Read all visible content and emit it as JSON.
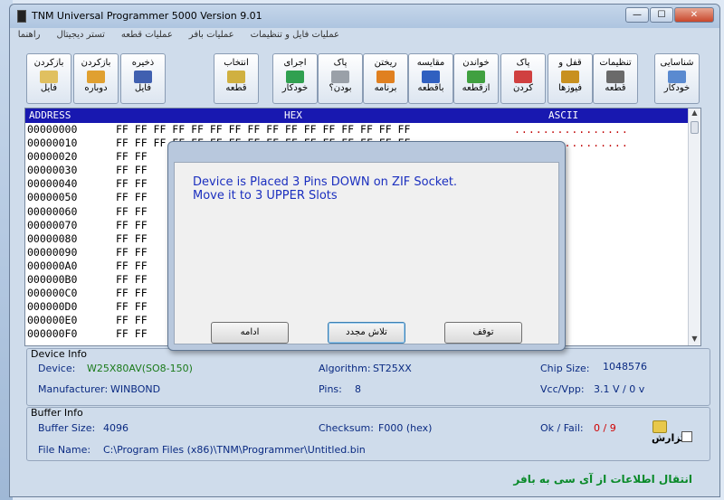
{
  "window": {
    "title": "TNM  Universal Programmer 5000   Version 9.01",
    "buttons": {
      "minimize": "—",
      "maximize": "☐",
      "close": "✕"
    }
  },
  "menu": [
    "عملیات فایل و تنظیمات",
    "عملیات بافر",
    "عملیات قطعه",
    "تستر دیجیتال",
    "راهنما"
  ],
  "toolbar": [
    {
      "l1": "شناسایی",
      "l2": "خودکار",
      "icon": "chip-search-icon",
      "color": "#5a8ad0"
    },
    {
      "l1": "تنظیمات",
      "l2": "قطعه",
      "icon": "chip-settings-icon",
      "color": "#6a6a6a"
    },
    {
      "l1": "قفل و",
      "l2": "فیوزها",
      "icon": "lock-icon",
      "color": "#c89020"
    },
    {
      "l1": "پاک",
      "l2": "کردن",
      "icon": "eraser-icon",
      "color": "#d04040"
    },
    {
      "l1": "خواندن",
      "l2": "ازقطعه",
      "icon": "read-chip-icon",
      "color": "#40a040"
    },
    {
      "l1": "مقایسه",
      "l2": "باقطعه",
      "icon": "compare-icon",
      "color": "#3060c0"
    },
    {
      "l1": "ریختن",
      "l2": "برنامه",
      "icon": "program-chip-icon",
      "color": "#e08020"
    },
    {
      "l1": "پاک",
      "l2": "بودن؟",
      "icon": "blank-check-icon",
      "color": "#9aa0a8"
    },
    {
      "l1": "اجرای",
      "l2": "خودکار",
      "icon": "auto-run-icon",
      "color": "#30a050"
    },
    {
      "l1": "انتخاب",
      "l2": "قطعه",
      "icon": "select-chip-icon",
      "color": "#d0b040"
    },
    {
      "l1": "ذخیره",
      "l2": "فایل",
      "icon": "save-file-icon",
      "color": "#4060b0"
    },
    {
      "l1": "بازکردن",
      "l2": "دوباره",
      "icon": "reopen-file-icon",
      "color": "#e0a030"
    },
    {
      "l1": "بازکردن",
      "l2": "فایل",
      "icon": "open-file-icon",
      "color": "#e0c060"
    }
  ],
  "grid": {
    "headers": {
      "address": "ADDRESS",
      "hex": "HEX",
      "ascii": "ASCII"
    },
    "rows": [
      {
        "addr": "00000000",
        "hex": "FF FF FF FF FF FF FF FF FF FF FF FF FF FF FF FF",
        "asc": "................"
      },
      {
        "addr": "00000010",
        "hex": "FF FF FF FF FF FF FF FF FF FF FF FF FF FF FF FF",
        "asc": "................"
      },
      {
        "addr": "00000020",
        "hex": "FF FF",
        "asc": ""
      },
      {
        "addr": "00000030",
        "hex": "FF FF",
        "asc": ""
      },
      {
        "addr": "00000040",
        "hex": "FF FF",
        "asc": ""
      },
      {
        "addr": "00000050",
        "hex": "FF FF",
        "asc": ""
      },
      {
        "addr": "00000060",
        "hex": "FF FF",
        "asc": ""
      },
      {
        "addr": "00000070",
        "hex": "FF FF",
        "asc": ""
      },
      {
        "addr": "00000080",
        "hex": "FF FF",
        "asc": ""
      },
      {
        "addr": "00000090",
        "hex": "FF FF",
        "asc": ""
      },
      {
        "addr": "000000A0",
        "hex": "FF FF",
        "asc": ""
      },
      {
        "addr": "000000B0",
        "hex": "FF FF",
        "asc": ""
      },
      {
        "addr": "000000C0",
        "hex": "FF FF",
        "asc": ""
      },
      {
        "addr": "000000D0",
        "hex": "FF FF",
        "asc": ""
      },
      {
        "addr": "000000E0",
        "hex": "FF FF",
        "asc": ""
      },
      {
        "addr": "000000F0",
        "hex": "FF FF",
        "asc": ""
      }
    ]
  },
  "dialog": {
    "line1": "Device is Placed 3 Pins  DOWN  on ZIF Socket.",
    "line2": "Move it to  3   UPPER   Slots",
    "btn_continue": "ادامه",
    "btn_retry": "تلاش مجدد",
    "btn_stop": "توقف"
  },
  "device_info": {
    "title": "Device Info",
    "device_label": "Device:",
    "device_value": "W25X80AV(SO8-150)",
    "manufacturer_label": "Manufacturer:",
    "manufacturer_value": "WINBOND",
    "algorithm_label": "Algorithm:",
    "algorithm_value": "ST25XX",
    "pins_label": "Pins:",
    "pins_value": "8",
    "chip_size_label": "Chip Size:",
    "chip_size_value": "1048576",
    "vcc_label": "Vcc/Vpp:",
    "vcc_value": "3.1 V / 0 v"
  },
  "buffer_info": {
    "title": "Buffer Info",
    "size_label": "Buffer Size:",
    "size_value": "4096",
    "checksum_label": "Checksum:",
    "checksum_value": "F000 (hex)",
    "okfail_label": "Ok / Fail:",
    "okfail_value": "0 / 9",
    "file_label": "File Name:",
    "file_value": "C:\\Program Files (x86)\\TNM\\Programmer\\Untitled.bin",
    "report_label": "گزارش"
  },
  "footer": "انتقال اطلاعات از آی سی به بافر"
}
